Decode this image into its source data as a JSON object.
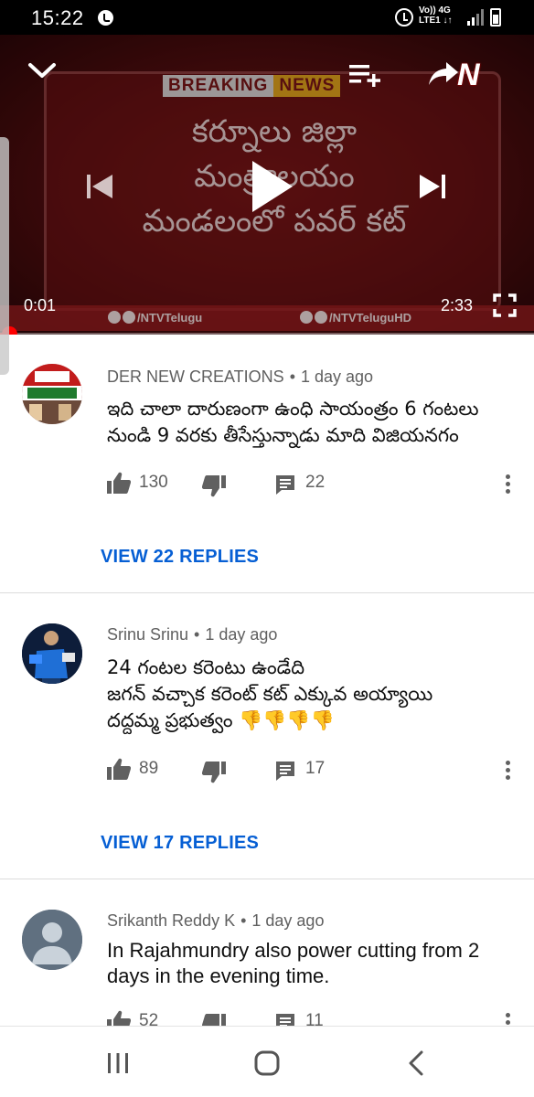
{
  "status_bar": {
    "time": "15:22",
    "net_top": "Vo)) 4G",
    "net_bottom": "LTE1 ↓↑"
  },
  "player": {
    "breaking_1": "BREAKING",
    "breaking_2": "NEWS",
    "headline_line1": "కర్నూలు జిల్లా",
    "headline_line2": "మంత్రాలయం",
    "headline_line3": "మండలంలో పవర్ కట్",
    "channel_logo": "N",
    "social_left": "/NTVTelugu",
    "social_right": "/NTVTeluguHD",
    "current_time": "0:01",
    "duration": "2:33",
    "progress": 0.0065
  },
  "comments": [
    {
      "author": "DER NEW CREATIONS",
      "time": "1 day ago",
      "text": "ఇది చాలా దారుణంగా ఉంధి సాయంత్రం 6 గంటలు నుండి 9 వరకు తీసేస్తున్నాడు మాది విజియనగం",
      "likes": "130",
      "replies": "22",
      "view_replies": "VIEW 22 REPLIES"
    },
    {
      "author": "Srinu Srinu",
      "time": "1 day ago",
      "text_line1": "24 గంటల కరెంటు ఉండేది",
      "text_line2": "జగన్ వచ్చాక కరెంట్ కట్ ఎక్కువ అయ్యాయి",
      "text_line3": "దద్దమ్మ ప్రభుత్వం 👎👎👎👎",
      "likes": "89",
      "replies": "17",
      "view_replies": "VIEW 17 REPLIES"
    },
    {
      "author": "Srikanth Reddy K",
      "time": "1 day ago",
      "text": "In Rajahmundry also power cutting from 2 days in the evening time.",
      "likes": "52",
      "replies": "11"
    }
  ],
  "separator": "•",
  "colors": {
    "accent_blue": "#065fd4",
    "progress_red": "#ff0000",
    "meta_gray": "#606060"
  }
}
